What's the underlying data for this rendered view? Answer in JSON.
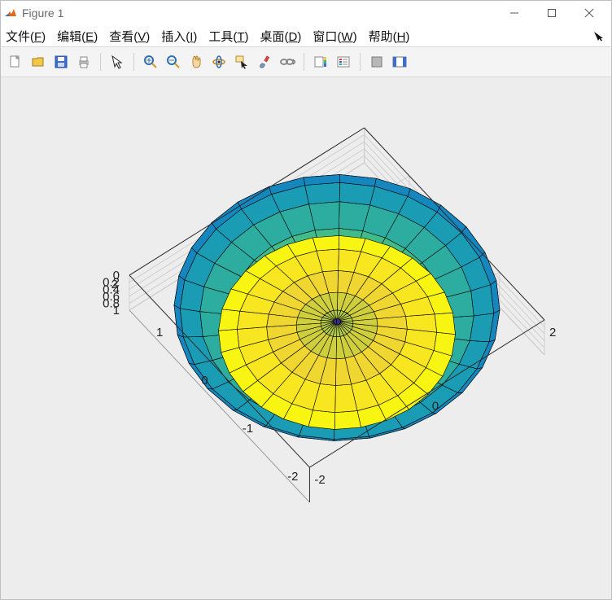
{
  "window": {
    "title": "Figure 1"
  },
  "menus": {
    "file": {
      "label_pre": "文件(",
      "hotkey": "F",
      "label_post": ")"
    },
    "edit": {
      "label_pre": "编辑(",
      "hotkey": "E",
      "label_post": ")"
    },
    "view": {
      "label_pre": "查看(",
      "hotkey": "V",
      "label_post": ")"
    },
    "insert": {
      "label_pre": "插入(",
      "hotkey": "I",
      "label_post": ")"
    },
    "tools": {
      "label_pre": "工具(",
      "hotkey": "T",
      "label_post": ")"
    },
    "desktop": {
      "label_pre": "桌面(",
      "hotkey": "D",
      "label_post": ")"
    },
    "window": {
      "label_pre": "窗口(",
      "hotkey": "W",
      "label_post": ")"
    },
    "help": {
      "label_pre": "帮助(",
      "hotkey": "H",
      "label_post": ")"
    }
  },
  "toolbar_icons": {
    "new": "new-file-icon",
    "open": "open-folder-icon",
    "save": "save-icon",
    "print": "print-icon",
    "pointer": "pointer-icon",
    "zoom_in": "zoom-in-icon",
    "zoom_out": "zoom-out-icon",
    "pan": "pan-icon",
    "rotate": "rotate-3d-icon",
    "data_cursor": "data-cursor-icon",
    "brush": "brush-icon",
    "link": "link-axes-icon",
    "colorbar": "colorbar-icon",
    "legend": "legend-icon",
    "hide_tools": "hide-tools-icon",
    "dock": "dock-figure-icon"
  },
  "chart_data": {
    "type": "surface-3d",
    "description": "Parametric sphere-like surface of revolution: a bulbous lower lobe (teal→blue) and an upward-flaring funnel top (yellow), meeting at a narrow neck near z≈0.65. Wireframe edges shown in black.",
    "expression_hint": "surf generated from [X,Y,Z]=sphere(n) followed by a radial/axial warp producing the funnel+lobe profile",
    "parametric": {
      "theta_samples": 28,
      "phi_samples": 20,
      "profile_rz": [
        [
          0.0,
          0.0
        ],
        [
          0.6,
          0.02
        ],
        [
          1.2,
          0.06
        ],
        [
          1.7,
          0.12
        ],
        [
          2.05,
          0.2
        ],
        [
          2.2,
          0.29
        ],
        [
          2.12,
          0.38
        ],
        [
          1.85,
          0.46
        ],
        [
          1.45,
          0.53
        ],
        [
          1.0,
          0.59
        ],
        [
          0.55,
          0.63
        ],
        [
          0.18,
          0.66
        ],
        [
          0.05,
          0.69
        ],
        [
          0.22,
          0.74
        ],
        [
          0.55,
          0.8
        ],
        [
          0.95,
          0.87
        ],
        [
          1.35,
          0.95
        ],
        [
          1.6,
          1.0
        ]
      ]
    },
    "colormap": "parula",
    "color_by": "z",
    "edge_color": "#000000",
    "axes": {
      "x": {
        "lim": [
          -2,
          2
        ],
        "ticks": [
          -2,
          0,
          2
        ]
      },
      "y": {
        "lim": [
          -2,
          2
        ],
        "ticks": [
          -2,
          -1,
          0,
          1,
          2
        ]
      },
      "z": {
        "lim": [
          0,
          1
        ],
        "ticks": [
          0,
          0.2,
          0.4,
          0.6,
          0.8,
          1
        ]
      }
    },
    "view": {
      "azimuth_deg": -37.5,
      "elevation_deg": 30
    },
    "grid": true,
    "box": true
  }
}
